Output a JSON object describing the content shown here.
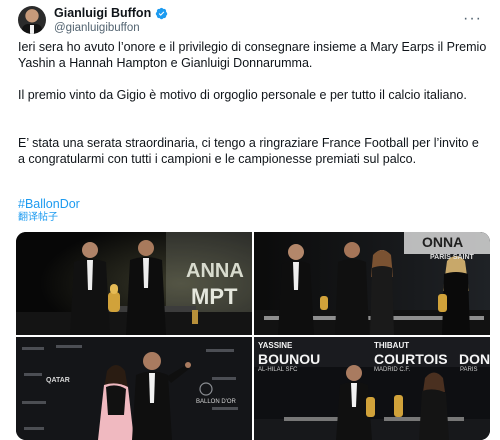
{
  "author": {
    "display_name": "Gianluigi Buffon",
    "handle": "@gianluigibuffon",
    "verified_icon": "verified-badge-icon",
    "verified_color": "#1d9bf0"
  },
  "post": {
    "paragraphs": [
      "Ieri sera ho avuto l’onore e il privilegio di consegnare insieme a Mary Earps il Premio Yashin a Hannah Hampton e Gianluigi Donnarumma.",
      "Il premio vinto da Gigio è motivo di orgoglio personale e per tutto il calcio italiano.",
      "E’ stata una serata straordinaria, ci tengo a ringraziare France Football per l’invito e a congratularmi con tutti i campioni e le campionesse premiati sul palco."
    ],
    "hashtag": "#BallonDor",
    "translate_label": "翻译帖子"
  },
  "photos": {
    "photo1": {
      "backdrop_text": "ANNA",
      "backdrop_text2": "MPT"
    },
    "photo2": {
      "backdrop_text": "ONNA",
      "backdrop_sub": "PARIS SAINT"
    },
    "photo3": {
      "logo_text": "QATAR",
      "logo_sub": "BALLON D'OR"
    },
    "photo4": {
      "left_name_top": "YASSINE",
      "left_name": "BOUNOU",
      "left_club": "AL-HILAL SFC",
      "right_name_top": "THIBAUT",
      "right_name": "COURTOIS",
      "right_club": "MADRID C.F.",
      "right_name_cut": "DONN",
      "right_club_cut": "PARIS"
    }
  },
  "colors": {
    "link": "#1d9bf0",
    "text": "#0f1419",
    "secondary": "#536471"
  }
}
